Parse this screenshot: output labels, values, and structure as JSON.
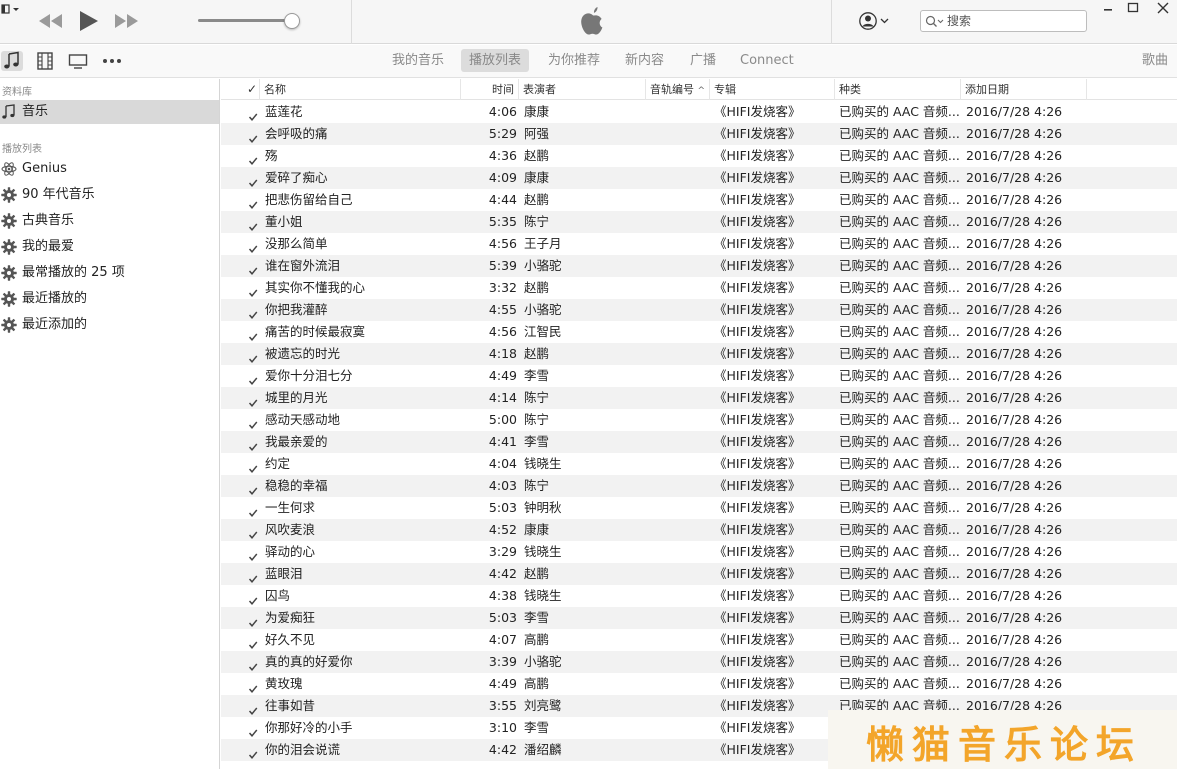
{
  "player": {
    "menu_icon": "menu-icon",
    "transport_icons": [
      "previous-track-icon",
      "play-icon",
      "next-track-icon"
    ],
    "volume_level": 0.9,
    "center_logo": "apple-logo-icon",
    "account_icon": "account-icon",
    "search": {
      "placeholder": "搜索",
      "value": ""
    }
  },
  "toolbar": {
    "media_icons": [
      "music-icon",
      "movies-icon",
      "tv-icon",
      "more-icon"
    ],
    "tabs": [
      {
        "label": "我的音乐",
        "active": false
      },
      {
        "label": "播放列表",
        "active": true
      },
      {
        "label": "为你推荐",
        "active": false
      },
      {
        "label": "新内容",
        "active": false
      },
      {
        "label": "广播",
        "active": false
      },
      {
        "label": "Connect",
        "active": false
      }
    ],
    "view_label": "歌曲"
  },
  "sidebar": {
    "library_header": "资料库",
    "library_items": [
      {
        "label": "音乐",
        "icon": "music-note-icon",
        "selected": true
      }
    ],
    "playlists_header": "播放列表",
    "playlist_items": [
      {
        "label": "Genius",
        "icon": "genius-icon"
      },
      {
        "label": "90 年代音乐",
        "icon": "smart-playlist-gear-icon"
      },
      {
        "label": "古典音乐",
        "icon": "smart-playlist-gear-icon"
      },
      {
        "label": "我的最爱",
        "icon": "smart-playlist-gear-icon"
      },
      {
        "label": "最常播放的 25 项",
        "icon": "smart-playlist-gear-icon"
      },
      {
        "label": "最近播放的",
        "icon": "smart-playlist-gear-icon"
      },
      {
        "label": "最近添加的",
        "icon": "smart-playlist-gear-icon"
      }
    ]
  },
  "table": {
    "columns": {
      "check": "✓",
      "name": "名称",
      "time": "时间",
      "artist": "表演者",
      "track_no": "音轨编号",
      "album": "专辑",
      "genre": "种类",
      "date_added": "添加日期"
    },
    "sort_column": "track_no",
    "rows": [
      {
        "name": "蓝莲花",
        "time": "4:06",
        "artist": "康康",
        "album": "《HIFI发烧客》",
        "genre": "已购买的 AAC 音频...",
        "added": "2016/7/28 4:26"
      },
      {
        "name": "会呼吸的痛",
        "time": "5:29",
        "artist": "阿强",
        "album": "《HIFI发烧客》",
        "genre": "已购买的 AAC 音频...",
        "added": "2016/7/28 4:26"
      },
      {
        "name": "殇",
        "time": "4:36",
        "artist": "赵鹏",
        "album": "《HIFI发烧客》",
        "genre": "已购买的 AAC 音频...",
        "added": "2016/7/28 4:26"
      },
      {
        "name": "爱碎了痴心",
        "time": "4:09",
        "artist": "康康",
        "album": "《HIFI发烧客》",
        "genre": "已购买的 AAC 音频...",
        "added": "2016/7/28 4:26"
      },
      {
        "name": "把悲伤留给自己",
        "time": "4:44",
        "artist": "赵鹏",
        "album": "《HIFI发烧客》",
        "genre": "已购买的 AAC 音频...",
        "added": "2016/7/28 4:26"
      },
      {
        "name": "董小姐",
        "time": "5:35",
        "artist": "陈宁",
        "album": "《HIFI发烧客》",
        "genre": "已购买的 AAC 音频...",
        "added": "2016/7/28 4:26"
      },
      {
        "name": "没那么简单",
        "time": "4:56",
        "artist": "王子月",
        "album": "《HIFI发烧客》",
        "genre": "已购买的 AAC 音频...",
        "added": "2016/7/28 4:26"
      },
      {
        "name": "谁在窗外流泪",
        "time": "5:39",
        "artist": "小骆驼",
        "album": "《HIFI发烧客》",
        "genre": "已购买的 AAC 音频...",
        "added": "2016/7/28 4:26"
      },
      {
        "name": "其实你不懂我的心",
        "time": "3:32",
        "artist": "赵鹏",
        "album": "《HIFI发烧客》",
        "genre": "已购买的 AAC 音频...",
        "added": "2016/7/28 4:26"
      },
      {
        "name": "你把我灌醉",
        "time": "4:55",
        "artist": "小骆驼",
        "album": "《HIFI发烧客》",
        "genre": "已购买的 AAC 音频...",
        "added": "2016/7/28 4:26"
      },
      {
        "name": "痛苦的时候最寂寞",
        "time": "4:56",
        "artist": "江智民",
        "album": "《HIFI发烧客》",
        "genre": "已购买的 AAC 音频...",
        "added": "2016/7/28 4:26"
      },
      {
        "name": "被遗忘的时光",
        "time": "4:18",
        "artist": "赵鹏",
        "album": "《HIFI发烧客》",
        "genre": "已购买的 AAC 音频...",
        "added": "2016/7/28 4:26"
      },
      {
        "name": "爱你十分泪七分",
        "time": "4:49",
        "artist": "李雪",
        "album": "《HIFI发烧客》",
        "genre": "已购买的 AAC 音频...",
        "added": "2016/7/28 4:26"
      },
      {
        "name": "城里的月光",
        "time": "4:14",
        "artist": "陈宁",
        "album": "《HIFI发烧客》",
        "genre": "已购买的 AAC 音频...",
        "added": "2016/7/28 4:26"
      },
      {
        "name": "感动天感动地",
        "time": "5:00",
        "artist": "陈宁",
        "album": "《HIFI发烧客》",
        "genre": "已购买的 AAC 音频...",
        "added": "2016/7/28 4:26"
      },
      {
        "name": "我最亲爱的",
        "time": "4:41",
        "artist": "李雪",
        "album": "《HIFI发烧客》",
        "genre": "已购买的 AAC 音频...",
        "added": "2016/7/28 4:26"
      },
      {
        "name": "约定",
        "time": "4:04",
        "artist": "钱晓生",
        "album": "《HIFI发烧客》",
        "genre": "已购买的 AAC 音频...",
        "added": "2016/7/28 4:26"
      },
      {
        "name": "稳稳的幸福",
        "time": "4:03",
        "artist": "陈宁",
        "album": "《HIFI发烧客》",
        "genre": "已购买的 AAC 音频...",
        "added": "2016/7/28 4:26"
      },
      {
        "name": "一生何求",
        "time": "5:03",
        "artist": "钟明秋",
        "album": "《HIFI发烧客》",
        "genre": "已购买的 AAC 音频...",
        "added": "2016/7/28 4:26"
      },
      {
        "name": "风吹麦浪",
        "time": "4:52",
        "artist": "康康",
        "album": "《HIFI发烧客》",
        "genre": "已购买的 AAC 音频...",
        "added": "2016/7/28 4:26"
      },
      {
        "name": "驿动的心",
        "time": "3:29",
        "artist": "钱晓生",
        "album": "《HIFI发烧客》",
        "genre": "已购买的 AAC 音频...",
        "added": "2016/7/28 4:26"
      },
      {
        "name": "蓝眼泪",
        "time": "4:42",
        "artist": "赵鹏",
        "album": "《HIFI发烧客》",
        "genre": "已购买的 AAC 音频...",
        "added": "2016/7/28 4:26"
      },
      {
        "name": "囚鸟",
        "time": "4:38",
        "artist": "钱晓生",
        "album": "《HIFI发烧客》",
        "genre": "已购买的 AAC 音频...",
        "added": "2016/7/28 4:26"
      },
      {
        "name": "为爱痴狂",
        "time": "5:03",
        "artist": "李雪",
        "album": "《HIFI发烧客》",
        "genre": "已购买的 AAC 音频...",
        "added": "2016/7/28 4:26"
      },
      {
        "name": "好久不见",
        "time": "4:07",
        "artist": "高鹏",
        "album": "《HIFI发烧客》",
        "genre": "已购买的 AAC 音频...",
        "added": "2016/7/28 4:26"
      },
      {
        "name": "真的真的好爱你",
        "time": "3:39",
        "artist": "小骆驼",
        "album": "《HIFI发烧客》",
        "genre": "已购买的 AAC 音频...",
        "added": "2016/7/28 4:26"
      },
      {
        "name": "黄玫瑰",
        "time": "4:49",
        "artist": "高鹏",
        "album": "《HIFI发烧客》",
        "genre": "已购买的 AAC 音频...",
        "added": "2016/7/28 4:26"
      },
      {
        "name": "往事如昔",
        "time": "3:55",
        "artist": "刘亮鹭",
        "album": "《HIFI发烧客》",
        "genre": "已购买的 AAC 音频...",
        "added": "2016/7/28 4:26"
      },
      {
        "name": "你那好冷的小手",
        "time": "3:10",
        "artist": "李雪",
        "album": "《HIFI发烧客》",
        "genre": "",
        "added": ""
      },
      {
        "name": "你的泪会说谎",
        "time": "4:42",
        "artist": "潘绍麟",
        "album": "《HIFI发烧客》",
        "genre": "",
        "added": ""
      }
    ]
  },
  "watermark": {
    "text": "懒猫音乐论坛"
  }
}
